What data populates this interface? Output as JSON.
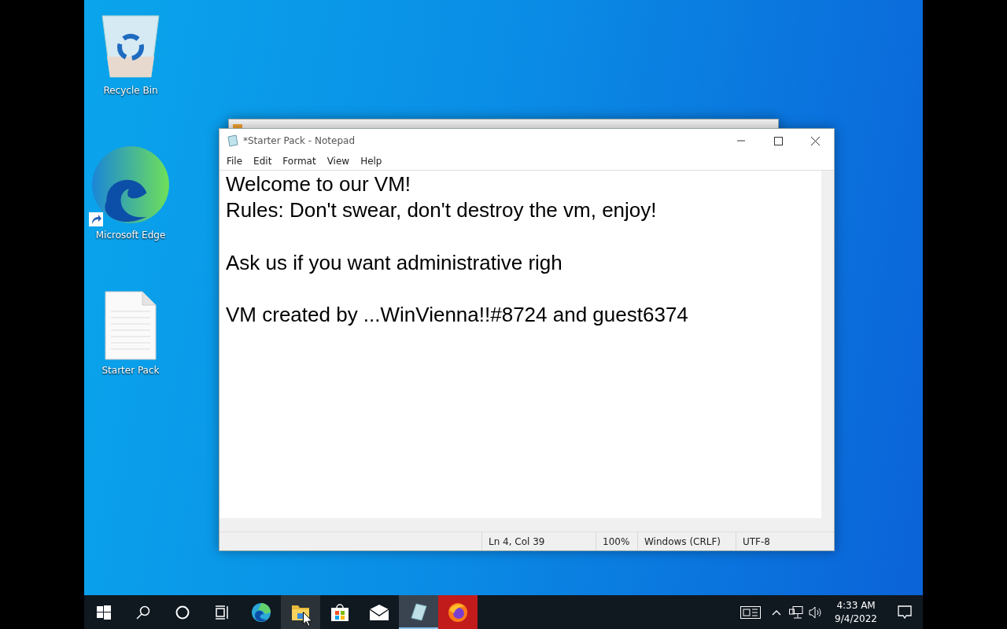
{
  "desktop_icons": [
    {
      "kind": "recycle",
      "label": "Recycle Bin"
    },
    {
      "kind": "edge",
      "label": "Microsoft Edge",
      "shortcut": true
    },
    {
      "kind": "document",
      "label": "Starter Pack"
    }
  ],
  "notepad": {
    "title": "*Starter Pack - Notepad",
    "menu": [
      "File",
      "Edit",
      "Format",
      "View",
      "Help"
    ],
    "text": "Welcome to our VM!\nRules: Don't swear, don't destroy the vm, enjoy!\n\nAsk us if you want administrative righ\n\nVM created by ...WinVienna!!#8724 and guest6374",
    "status": [
      "Ln 4, Col 39",
      "100%",
      "Windows (CRLF)",
      "UTF-8"
    ]
  },
  "taskbar": {
    "items": [
      {
        "kind": "start",
        "selected": false,
        "hovered": false,
        "flashing": false
      },
      {
        "kind": "search",
        "selected": false,
        "hovered": false,
        "flashing": false
      },
      {
        "kind": "cortana",
        "selected": false,
        "hovered": false,
        "flashing": false
      },
      {
        "kind": "taskview",
        "selected": false,
        "hovered": false,
        "flashing": false
      },
      {
        "kind": "edge",
        "selected": false,
        "hovered": false,
        "flashing": false
      },
      {
        "kind": "explorer",
        "selected": false,
        "hovered": true,
        "flashing": false
      },
      {
        "kind": "store",
        "selected": false,
        "hovered": false,
        "flashing": false
      },
      {
        "kind": "mail",
        "selected": false,
        "hovered": false,
        "flashing": false
      },
      {
        "kind": "notepad",
        "selected": true,
        "hovered": false,
        "flashing": false
      },
      {
        "kind": "firefox",
        "selected": false,
        "hovered": false,
        "flashing": true
      }
    ],
    "time": "4:33 AM",
    "date": "9/4/2022"
  }
}
